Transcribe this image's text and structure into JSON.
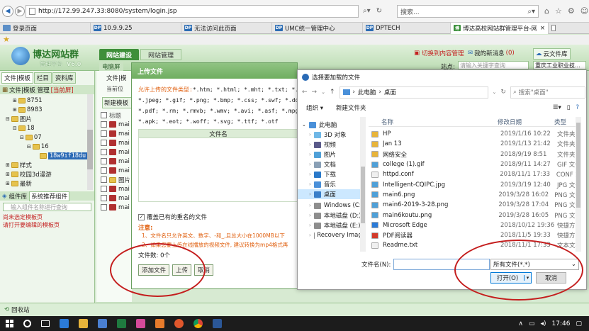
{
  "browser": {
    "address": "http://172.99.247.33:8080/system/login.jsp",
    "search_placeholder": "搜索...",
    "tabs": [
      {
        "label": "登录页面",
        "active": false
      },
      {
        "label": "10.9.9.25",
        "active": false
      },
      {
        "label": "无法访问此页面",
        "active": false
      },
      {
        "label": "UMC统一管理中心",
        "active": false
      },
      {
        "label": "DPTECH",
        "active": false
      },
      {
        "label": "博达高校网站群管理平台-网...",
        "active": true
      }
    ],
    "tab_close": "×"
  },
  "app": {
    "logo_title": "博达网站群",
    "logo_sub": "管理平台",
    "version": "V6.0",
    "tab_site": "网站建设",
    "tab_manage": "网站管理",
    "sub_tab": "电脑屏",
    "switch_content": "切换到内容管理",
    "my_messages": "我的新消息",
    "msg_count": "(0)",
    "cloud_library": "云文件库",
    "site_label": "站点:",
    "site_search_placeholder": "请输入关键字查询",
    "site_name": "重庆工业职业技..."
  },
  "left_panel": {
    "tabs": [
      "文件|模板",
      "栏目",
      "资料库"
    ],
    "header": "文件|模板 管理",
    "header_badge": "[当前屏]",
    "tree": [
      {
        "label": "8751",
        "level": 1
      },
      {
        "label": "8983",
        "level": 1
      },
      {
        "label": "图片",
        "level": 0
      },
      {
        "label": "18",
        "level": 1
      },
      {
        "label": "07",
        "level": 2
      },
      {
        "label": "16",
        "level": 3
      },
      {
        "label": "18w9if18du",
        "level": 4,
        "selected": true
      },
      {
        "label": "样式",
        "level": 0
      },
      {
        "label": "校园3d漫游",
        "level": 0
      },
      {
        "label": "最新",
        "level": 0
      }
    ],
    "component_header": "组件库",
    "component_select": "系统推荐组件",
    "component_search_placeholder": "输入组件名称进行查询",
    "no_component_line1": "尚未选定模板页",
    "no_component_line2": "请打开要编辑的模板页",
    "recycle": "回收站"
  },
  "middle": {
    "tab": "文件|模",
    "current": "当前位",
    "new_template": "新建模板",
    "header": "标题",
    "rows": [
      "mai",
      "mai",
      "mai",
      "mai",
      "mai",
      "mai",
      "图片",
      "mai",
      "mai",
      "mai"
    ]
  },
  "upload": {
    "title": "上传文件",
    "allowed_title": "允许上传的文件类型:",
    "types_line1": "*.htm; *.html; *.mht; *.txt; *.js; *.",
    "types_line2": "*.jpeg; *.gif; *.png; *.bmp; *.css; *.swf; *.doc; *.docx",
    "types_line3": "*.pdf; *.rm; *.rmvb; *.wmv; *.avi; *.asf; *.mpg; *.mpeg;",
    "types_line4": "*.apk; *.eot; *.woff; *.svg; *.ttf; *.otf",
    "col_filename": "文件名",
    "overwrite": "覆盖已有的重名的文件",
    "note_title": "注意:",
    "note1": "1、文件名只允许英文、数字、-和_,且总大小在1000MB以下",
    "note2": "2、如果您要上传在线播放的视频文件, 建议转换为mp4格式再",
    "file_count": "文件数: 0个",
    "add_button": "添加文件",
    "upload_button": "上传",
    "cancel_button": "取消"
  },
  "file_dialog": {
    "title": "选择要加载的文件",
    "path_root": "此电脑",
    "path_leaf": "桌面",
    "search_placeholder": "搜索\"桌面\"",
    "organize": "组织",
    "new_folder": "新建文件夹",
    "nav": [
      {
        "label": "此电脑",
        "indent": 0,
        "icon": "pc"
      },
      {
        "label": "3D 对象",
        "indent": 1,
        "icon": "3d"
      },
      {
        "label": "视频",
        "indent": 1,
        "icon": "video"
      },
      {
        "label": "图片",
        "indent": 1,
        "icon": "picture"
      },
      {
        "label": "文档",
        "indent": 1,
        "icon": "doc"
      },
      {
        "label": "下载",
        "indent": 1,
        "icon": "download"
      },
      {
        "label": "音乐",
        "indent": 1,
        "icon": "music"
      },
      {
        "label": "桌面",
        "indent": 1,
        "icon": "desktop",
        "selected": true
      },
      {
        "label": "Windows (C:)",
        "indent": 1,
        "icon": "drive"
      },
      {
        "label": "本地磁盘 (D:)",
        "indent": 1,
        "icon": "drive"
      },
      {
        "label": "本地磁盘 (E:)",
        "indent": 1,
        "icon": "drive"
      },
      {
        "label": "Recovery Image",
        "indent": 1,
        "icon": "drive"
      }
    ],
    "columns": [
      "名称",
      "修改日期",
      "类型"
    ],
    "files": [
      {
        "name": "HP",
        "date": "2019/1/16 10:22",
        "type": "文件夹",
        "icon": "folder"
      },
      {
        "name": "Jan 13",
        "date": "2019/1/13 21:42",
        "type": "文件夹",
        "icon": "folder"
      },
      {
        "name": "网络安全",
        "date": "2018/9/19 8:51",
        "type": "文件夹",
        "icon": "folder"
      },
      {
        "name": "college (1).gif",
        "date": "2018/9/11 14:27",
        "type": "GIF 文件",
        "icon": "image"
      },
      {
        "name": "httpd.conf",
        "date": "2018/11/1 17:33",
        "type": "CONF 文",
        "icon": "file"
      },
      {
        "name": "Intelligent-CQIPC.jpg",
        "date": "2019/3/19 12:40",
        "type": "JPG 文件",
        "icon": "image"
      },
      {
        "name": "main6.png",
        "date": "2019/3/28 16:02",
        "type": "PNG 文件",
        "icon": "image"
      },
      {
        "name": "main6-2019-3-28.png",
        "date": "2019/3/28 17:04",
        "type": "PNG 文件",
        "icon": "image"
      },
      {
        "name": "main6koutu.png",
        "date": "2019/3/28 16:05",
        "type": "PNG 文件",
        "icon": "image"
      },
      {
        "name": "Microsoft Edge",
        "date": "2018/10/12 19:36",
        "type": "快捷方式",
        "icon": "edge"
      },
      {
        "name": "PDF阅读器",
        "date": "2018/11/5 19:33",
        "type": "快捷方式",
        "icon": "pdf"
      },
      {
        "name": "Readme.txt",
        "date": "2018/11/1 17:33",
        "type": "文本文档",
        "icon": "file"
      }
    ],
    "filename_label": "文件名(N):",
    "filename_value": "",
    "filetype": "所有文件(*.*)",
    "open_button": "打开(O)",
    "cancel_button": "取消"
  },
  "taskbar": {
    "time": "17:46"
  },
  "colors": {
    "accent": "#2e7d2e",
    "annotation": "#c41d1d",
    "upload_title": "#6fae60"
  }
}
